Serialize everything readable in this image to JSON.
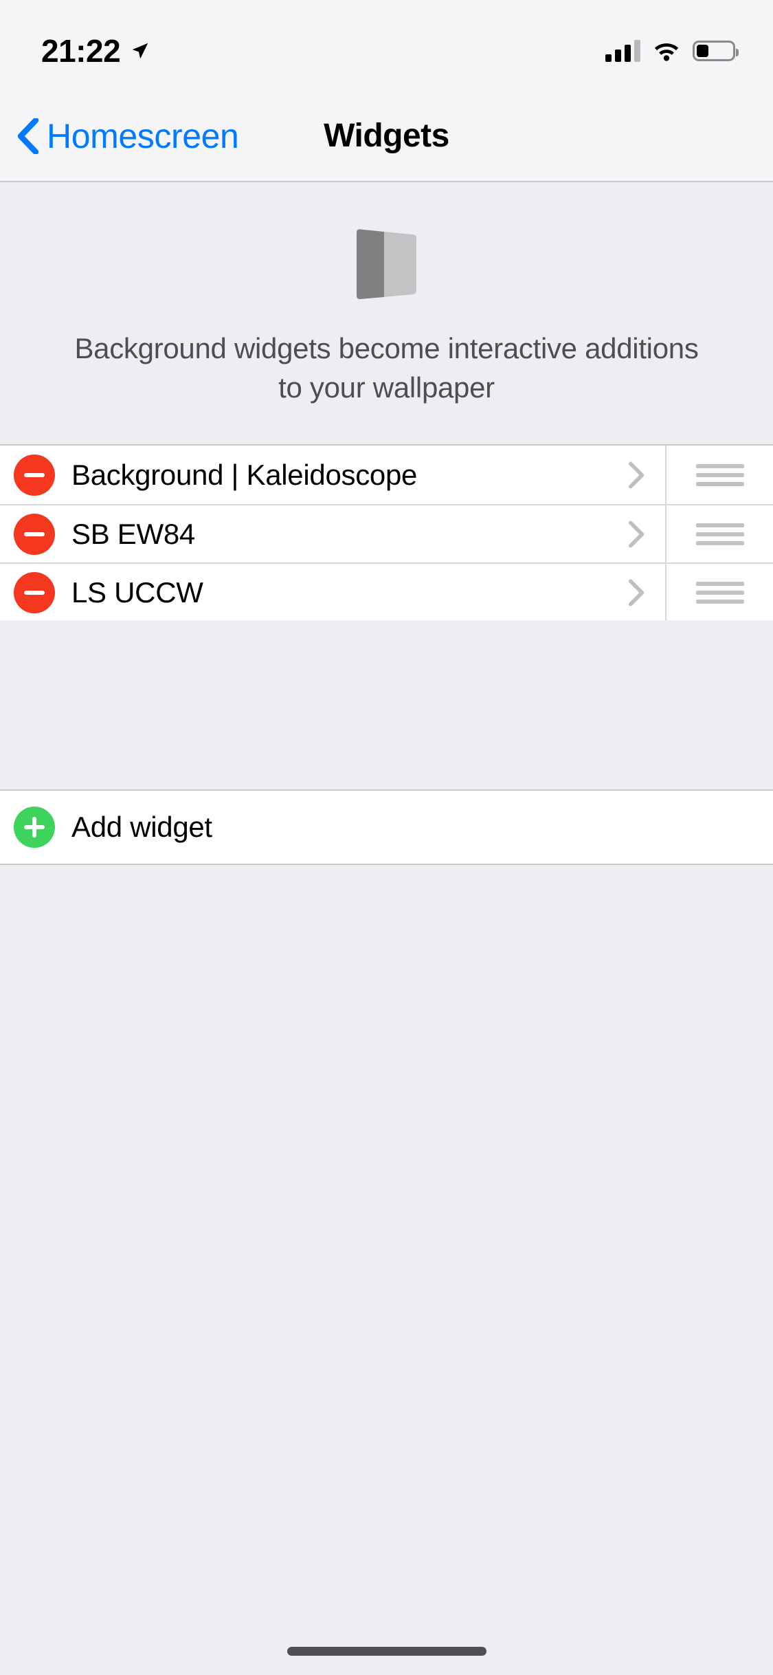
{
  "status_bar": {
    "time": "21:22",
    "location_icon": "location-arrow-icon",
    "signal_icon": "cellular-signal-icon",
    "signal_bars_filled": 3,
    "signal_bars_total": 4,
    "wifi_icon": "wifi-icon",
    "battery_icon": "battery-icon",
    "battery_level_percent": 30
  },
  "nav_bar": {
    "back_icon": "chevron-left-icon",
    "back_label": "Homescreen",
    "title": "Widgets",
    "accent_color": "#007AFF"
  },
  "header": {
    "icon_name": "widget-panels-icon",
    "icon_dark_color": "#808083",
    "icon_light_color": "#c3c3c5",
    "description": "Background widgets become interactive additions to your wallpaper"
  },
  "widgets_list": {
    "rows": [
      {
        "remove_icon": "minus-circle-icon",
        "label": "Background | Kaleidoscope",
        "disclosure_icon": "chevron-right-icon",
        "reorder_icon": "reorder-handle-icon"
      },
      {
        "remove_icon": "minus-circle-icon",
        "label": "SB EW84",
        "disclosure_icon": "chevron-right-icon",
        "reorder_icon": "reorder-handle-icon"
      },
      {
        "remove_icon": "minus-circle-icon",
        "label": "LS UCCW",
        "disclosure_icon": "chevron-right-icon",
        "reorder_icon": "reorder-handle-icon"
      }
    ],
    "remove_color": "#F4371F"
  },
  "add_row": {
    "add_icon": "plus-circle-icon",
    "label": "Add widget",
    "add_color": "#3DD35C"
  },
  "home_indicator": {
    "icon_name": "home-indicator"
  }
}
